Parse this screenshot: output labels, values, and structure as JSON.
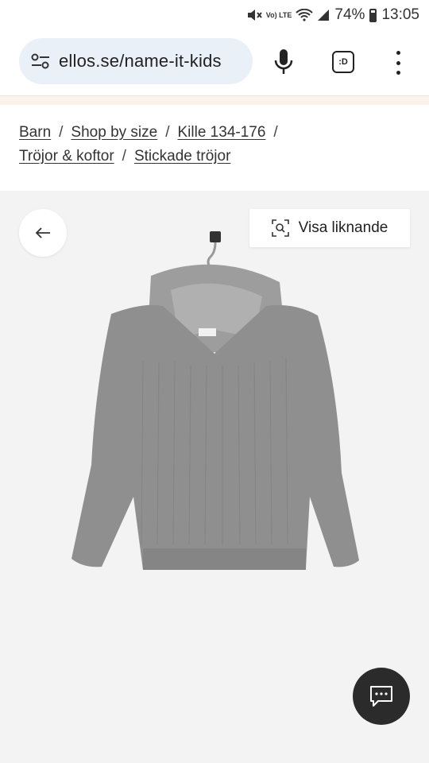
{
  "status_bar": {
    "battery": "74%",
    "time": "13:05",
    "network": "Vo) LTE"
  },
  "browser": {
    "url": "ellos.se/name-it-kids",
    "tab_label": ":D"
  },
  "breadcrumb": {
    "items": [
      {
        "label": "Barn"
      },
      {
        "label": "Shop by size"
      },
      {
        "label": "Kille 134-176"
      },
      {
        "label": "Tröjor & koftor"
      },
      {
        "label": "Stickade tröjor"
      }
    ],
    "separator": "/"
  },
  "product": {
    "similar_label": "Visa liknande",
    "image_icon": "grey-knitted-hoodie-on-hanger"
  },
  "icons": {
    "back": "arrow-left-icon",
    "search_similar": "image-search-icon",
    "chat": "chat-bubble-icon",
    "mic": "microphone-icon",
    "menu": "more-vertical-icon",
    "site_settings": "tune-icon"
  },
  "colors": {
    "url_bar_bg": "#eaf0f8",
    "image_bg": "#f3f3f3",
    "chat_button": "#2b2b2b",
    "sweater": "#8f8f8f"
  }
}
